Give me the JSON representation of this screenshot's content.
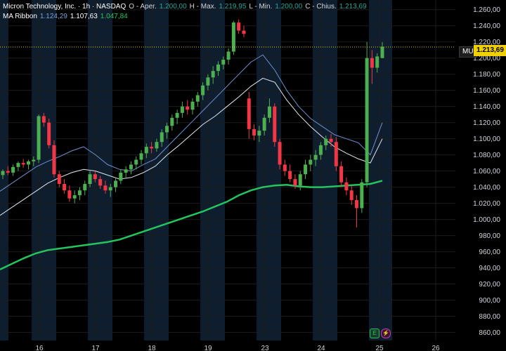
{
  "legend": {
    "symbol": "Micron Technology, Inc. · 1h · NASDAQ",
    "open_label": "O - Aper.",
    "open_value": "1.200,00",
    "high_label": "H - Max.",
    "high_value": "1.219,95",
    "low_label": "L - Min.",
    "low_value": "1.200,00",
    "close_label": "C - Chius.",
    "close_value": "1.213,69",
    "indicator_name": "MA Ribbon",
    "ma1": "1.124,29",
    "ma2": "1.107,63",
    "ma3": "1.047,84"
  },
  "price_tag": {
    "ticker": "MU",
    "price": "1.213,69"
  },
  "events": {
    "earnings": "E",
    "split": "⚡"
  },
  "colors": {
    "up": "#26a69a",
    "up_candle": "#4caf50",
    "down": "#f23645",
    "ma_fast": "#6f8fcf",
    "ma_mid": "#e0e6f0",
    "ma_slow": "#22c55e",
    "session_band": "#0f1e2e",
    "grid": "#1c1c1c",
    "price_line": "#f0d000"
  },
  "chart_data": {
    "type": "candlestick",
    "y_ticks": [
      "1.260,00",
      "1.240,00",
      "1.220,00",
      "1.200,00",
      "1.180,00",
      "1.160,00",
      "1.140,00",
      "1.120,00",
      "1.100,00",
      "1.080,00",
      "1.060,00",
      "1.040,00",
      "1.020,00",
      "1.000,00",
      "980,00",
      "960,00",
      "940,00",
      "920,00",
      "900,00",
      "880,00",
      "860,00"
    ],
    "ylim": [
      850,
      1265
    ],
    "x_labels": [
      "16",
      "17",
      "18",
      "19",
      "23",
      "24",
      "25",
      "26"
    ],
    "last_price": 1213.69,
    "candles": [
      [
        1055,
        1062,
        1050,
        1060
      ],
      [
        1060,
        1066,
        1055,
        1058
      ],
      [
        1058,
        1068,
        1054,
        1065
      ],
      [
        1065,
        1072,
        1060,
        1070
      ],
      [
        1070,
        1075,
        1064,
        1068
      ],
      [
        1068,
        1074,
        1062,
        1072
      ],
      [
        1072,
        1078,
        1066,
        1074
      ],
      [
        1074,
        1130,
        1070,
        1128
      ],
      [
        1128,
        1132,
        1115,
        1120
      ],
      [
        1120,
        1125,
        1088,
        1092
      ],
      [
        1092,
        1098,
        1052,
        1056
      ],
      [
        1056,
        1060,
        1040,
        1044
      ],
      [
        1044,
        1050,
        1032,
        1036
      ],
      [
        1036,
        1042,
        1022,
        1026
      ],
      [
        1026,
        1036,
        1020,
        1030
      ],
      [
        1030,
        1040,
        1024,
        1036
      ],
      [
        1036,
        1048,
        1030,
        1044
      ],
      [
        1044,
        1060,
        1040,
        1056
      ],
      [
        1056,
        1060,
        1046,
        1050
      ],
      [
        1050,
        1054,
        1038,
        1042
      ],
      [
        1042,
        1048,
        1032,
        1036
      ],
      [
        1036,
        1044,
        1028,
        1040
      ],
      [
        1040,
        1052,
        1034,
        1048
      ],
      [
        1048,
        1062,
        1044,
        1058
      ],
      [
        1058,
        1066,
        1052,
        1062
      ],
      [
        1062,
        1072,
        1056,
        1068
      ],
      [
        1068,
        1078,
        1062,
        1074
      ],
      [
        1074,
        1086,
        1068,
        1082
      ],
      [
        1082,
        1094,
        1076,
        1090
      ],
      [
        1090,
        1096,
        1082,
        1088
      ],
      [
        1088,
        1100,
        1084,
        1096
      ],
      [
        1096,
        1112,
        1090,
        1108
      ],
      [
        1108,
        1120,
        1100,
        1116
      ],
      [
        1116,
        1130,
        1110,
        1126
      ],
      [
        1126,
        1136,
        1118,
        1132
      ],
      [
        1132,
        1146,
        1126,
        1140
      ],
      [
        1140,
        1148,
        1130,
        1136
      ],
      [
        1136,
        1150,
        1130,
        1146
      ],
      [
        1146,
        1158,
        1140,
        1154
      ],
      [
        1154,
        1170,
        1148,
        1166
      ],
      [
        1166,
        1180,
        1160,
        1176
      ],
      [
        1176,
        1190,
        1168,
        1184
      ],
      [
        1184,
        1196,
        1178,
        1192
      ],
      [
        1192,
        1202,
        1186,
        1198
      ],
      [
        1198,
        1212,
        1192,
        1208
      ],
      [
        1208,
        1246,
        1204,
        1244
      ],
      [
        1244,
        1248,
        1230,
        1234
      ],
      [
        1234,
        1240,
        1226,
        1230
      ],
      [
        1150,
        1158,
        1100,
        1112
      ],
      [
        1112,
        1118,
        1098,
        1104
      ],
      [
        1104,
        1116,
        1096,
        1110
      ],
      [
        1110,
        1130,
        1104,
        1126
      ],
      [
        1126,
        1150,
        1120,
        1140
      ],
      [
        1140,
        1144,
        1090,
        1096
      ],
      [
        1096,
        1100,
        1062,
        1068
      ],
      [
        1068,
        1074,
        1054,
        1060
      ],
      [
        1060,
        1068,
        1046,
        1050
      ],
      [
        1050,
        1056,
        1038,
        1042
      ],
      [
        1042,
        1060,
        1036,
        1056
      ],
      [
        1056,
        1074,
        1050,
        1068
      ],
      [
        1068,
        1080,
        1060,
        1074
      ],
      [
        1074,
        1086,
        1066,
        1080
      ],
      [
        1080,
        1096,
        1074,
        1092
      ],
      [
        1092,
        1104,
        1086,
        1100
      ],
      [
        1100,
        1106,
        1090,
        1096
      ],
      [
        1096,
        1102,
        1060,
        1066
      ],
      [
        1066,
        1072,
        1040,
        1046
      ],
      [
        1046,
        1052,
        1030,
        1036
      ],
      [
        1036,
        1042,
        1018,
        1024
      ],
      [
        1024,
        1030,
        990,
        1014
      ],
      [
        1014,
        1050,
        1008,
        1046
      ],
      [
        1046,
        1220,
        1040,
        1200
      ],
      [
        1200,
        1210,
        1168,
        1188
      ],
      [
        1188,
        1206,
        1182,
        1202
      ],
      [
        1200,
        1220,
        1200,
        1214
      ]
    ],
    "ma_fast": [
      1035,
      1045,
      1055,
      1065,
      1072,
      1078,
      1085,
      1090,
      1080,
      1068,
      1062,
      1060,
      1068,
      1075,
      1090,
      1105,
      1120,
      1135,
      1150,
      1165,
      1180,
      1195,
      1204,
      1185,
      1160,
      1140,
      1125,
      1115,
      1105,
      1100,
      1095,
      1080,
      1120
    ],
    "ma_mid": [
      1005,
      1015,
      1025,
      1035,
      1045,
      1052,
      1058,
      1062,
      1060,
      1055,
      1050,
      1052,
      1058,
      1066,
      1080,
      1092,
      1105,
      1118,
      1128,
      1140,
      1152,
      1165,
      1175,
      1170,
      1148,
      1130,
      1115,
      1102,
      1090,
      1082,
      1075,
      1070,
      1100
    ],
    "ma_slow": [
      938,
      945,
      952,
      958,
      962,
      964,
      966,
      968,
      970,
      972,
      975,
      980,
      985,
      990,
      995,
      1000,
      1005,
      1010,
      1016,
      1022,
      1030,
      1036,
      1040,
      1042,
      1043,
      1041,
      1040,
      1040,
      1041,
      1042,
      1043,
      1044,
      1048
    ]
  }
}
